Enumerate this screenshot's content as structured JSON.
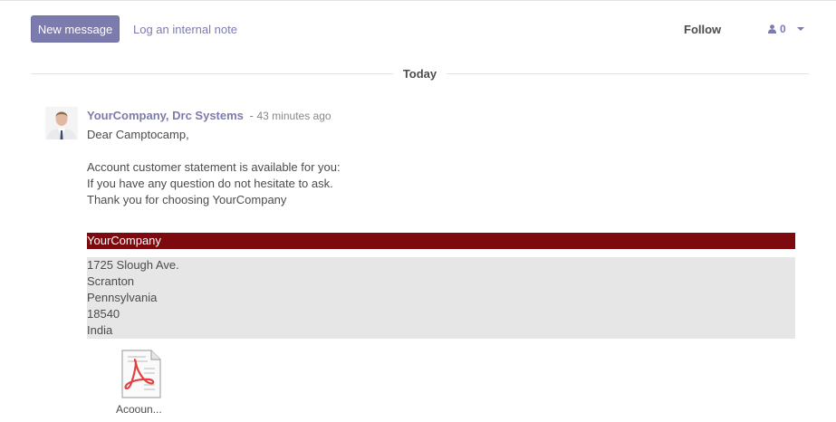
{
  "toolbar": {
    "new_message": "New message",
    "log_note": "Log an internal note",
    "follow": "Follow",
    "followers_count": "0"
  },
  "divider": {
    "label": "Today"
  },
  "message": {
    "author": "YourCompany, Drc Systems",
    "separator": "-",
    "date": "43 minutes ago",
    "greeting": "Dear Camptocamp,",
    "lines": [
      "Account customer statement is available for you:",
      "If you have any question do not hesitate to ask.",
      "Thank you for choosing YourCompany"
    ],
    "company_name": "YourCompany",
    "address": [
      "1725 Slough Ave.",
      "Scranton",
      "Pennsylvania",
      "18540",
      "India"
    ],
    "attachment_name": "Acooun..."
  },
  "colors": {
    "accent": "#7c7bad",
    "company_bar": "#7c0a0f",
    "address_bg": "#e6e6e6"
  }
}
